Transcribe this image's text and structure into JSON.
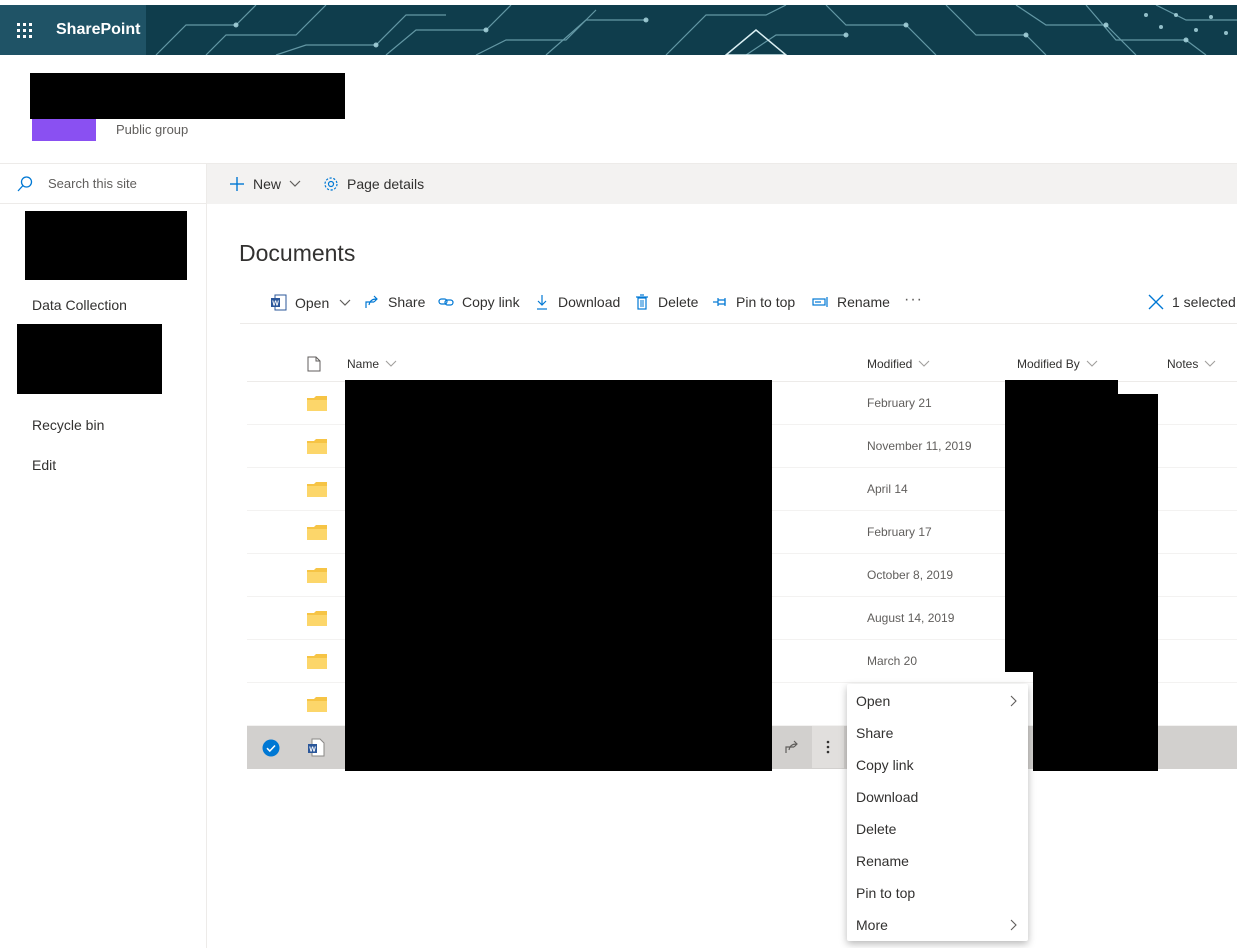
{
  "suite": {
    "app_name": "SharePoint"
  },
  "site": {
    "group_type": "Public group"
  },
  "search": {
    "placeholder": "Search this site"
  },
  "leftnav": {
    "items": [
      "Data Collection",
      "Recycle bin",
      "Edit"
    ]
  },
  "command_bar": {
    "new_label": "New",
    "page_details_label": "Page details"
  },
  "library": {
    "title": "Documents",
    "toolbar": {
      "open": "Open",
      "share": "Share",
      "copy_link": "Copy link",
      "download": "Download",
      "delete": "Delete",
      "pin_to_top": "Pin to top",
      "rename": "Rename",
      "more": "···",
      "selected_count": "1 selected"
    },
    "columns": {
      "name": "Name",
      "modified": "Modified",
      "modified_by": "Modified By",
      "notes": "Notes"
    },
    "rows": [
      {
        "type": "folder",
        "modified": "February 21"
      },
      {
        "type": "folder",
        "modified": "November 11, 2019"
      },
      {
        "type": "folder",
        "modified": "April 14"
      },
      {
        "type": "folder",
        "modified": "February 17"
      },
      {
        "type": "folder",
        "modified": "October 8, 2019"
      },
      {
        "type": "folder",
        "modified": "August 14, 2019"
      },
      {
        "type": "folder",
        "modified": "March 20"
      },
      {
        "type": "folder",
        "modified": ""
      },
      {
        "type": "word-document",
        "modified": "",
        "selected": true
      }
    ]
  },
  "context_menu": {
    "items": [
      "Open",
      "Share",
      "Copy link",
      "Download",
      "Delete",
      "Rename",
      "Pin to top",
      "More"
    ]
  },
  "colors": {
    "accent": "#0078d4",
    "suite_bar": "#0d3b4a",
    "folder": "#f6c445",
    "site_logo": "#8a50f2",
    "selected_row": "#d2d0ce"
  },
  "icons": {
    "waffle": "waffle-icon",
    "search": "search-icon",
    "plus": "plus-icon",
    "gear": "gear-icon",
    "word": "word-icon",
    "share": "share-icon",
    "link": "link-icon",
    "download": "download-icon",
    "delete": "trash-icon",
    "pin": "pin-icon",
    "rename": "rename-icon",
    "close": "close-icon",
    "file": "file-icon",
    "folder": "folder-icon",
    "check": "check-circle-icon"
  }
}
